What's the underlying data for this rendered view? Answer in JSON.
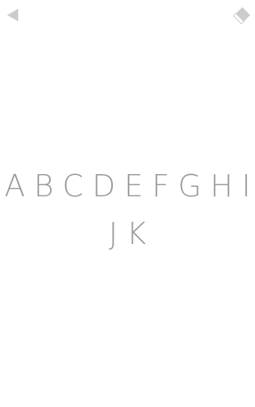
{
  "toolbar": {
    "back_icon": "back-triangle-icon",
    "erase_icon": "eraser-icon",
    "icon_color": "#cccccc"
  },
  "letters": {
    "row1": [
      "A",
      "B",
      "C",
      "D",
      "E",
      "F",
      "G",
      "H",
      "I"
    ],
    "row2": [
      "J",
      "K"
    ],
    "color": "#9a9a9a"
  }
}
